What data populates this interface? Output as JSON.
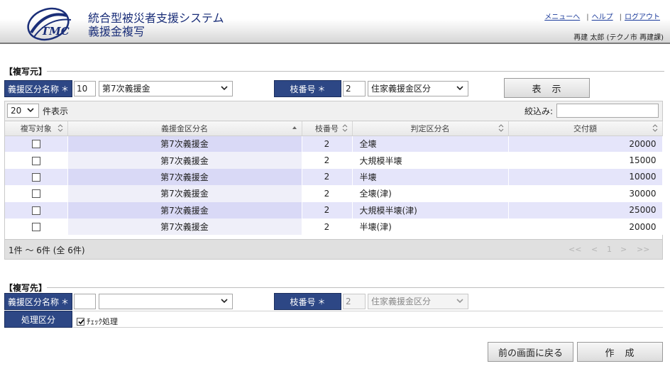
{
  "header": {
    "system_title": "統合型被災者支援システム",
    "page_title": "義援金複写",
    "logo_text": "TMC",
    "links": {
      "menu": "メニューへ",
      "help": "ヘルプ",
      "logout": "ログアウト"
    },
    "user_info": "再建  太郎 (テクノ市  再建課)"
  },
  "source": {
    "section_title": "【複写元】",
    "category_label": "義援区分名称",
    "required_mark": "＊",
    "category_code": "10",
    "category_name": "第7次義援金",
    "branch_label": "枝番号",
    "branch_code": "2",
    "branch_name": "住家義援金区分",
    "show_button": "表　示",
    "page_size": "20",
    "page_size_suffix": "件表示",
    "filter_label": "絞込み:",
    "filter_value": ""
  },
  "grid": {
    "columns": [
      "複写対象",
      "義援金区分名",
      "枝番号",
      "判定区分名",
      "交付額"
    ],
    "rows": [
      {
        "target": "",
        "fund": "第7次義援金",
        "branch": "2",
        "judge": "全壊",
        "amount": "20000"
      },
      {
        "target": "",
        "fund": "第7次義援金",
        "branch": "2",
        "judge": "大規模半壊",
        "amount": "15000"
      },
      {
        "target": "",
        "fund": "第7次義援金",
        "branch": "2",
        "judge": "半壊",
        "amount": "10000"
      },
      {
        "target": "",
        "fund": "第7次義援金",
        "branch": "2",
        "judge": "全壊(津)",
        "amount": "30000"
      },
      {
        "target": "",
        "fund": "第7次義援金",
        "branch": "2",
        "judge": "大規模半壊(津)",
        "amount": "25000"
      },
      {
        "target": "",
        "fund": "第7次義援金",
        "branch": "2",
        "judge": "半壊(津)",
        "amount": "20000"
      }
    ],
    "pager_info": "1件 ～ 6件 (全 6件)",
    "pager_buttons": {
      "first": "<<",
      "prev": "<",
      "page": "1",
      "next": ">",
      "last": ">>"
    }
  },
  "target": {
    "section_title": "【複写先】",
    "category_label": "義援区分名称",
    "required_mark": "＊",
    "category_code": "",
    "category_name": "",
    "branch_label": "枝番号",
    "branch_code": "2",
    "branch_name": "住家義援金区分",
    "process_label": "処理区分",
    "check_label": "ﾁｪｯｸ処理",
    "check_checked": true
  },
  "footer": {
    "back_button": "前の画面に戻る",
    "create_button": "作　成"
  },
  "colors": {
    "label_bg": "#2d4785",
    "title_text": "#1a2e78",
    "row_highlight": "#e5e5fa"
  }
}
